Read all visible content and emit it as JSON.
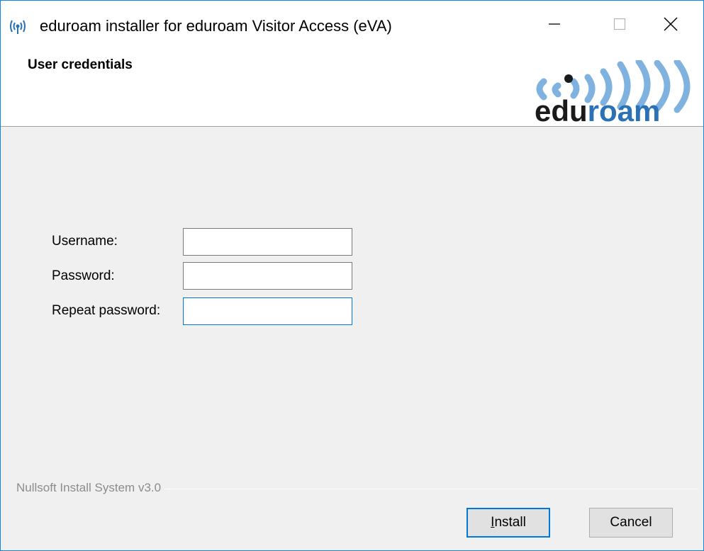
{
  "window": {
    "title": "eduroam installer for eduroam Visitor Access (eVA)"
  },
  "header": {
    "title": "User credentials",
    "logo_text": "eduroam",
    "logo_colors": {
      "edu": "#1a1a1a",
      "roam": "#2a72b5",
      "waves": "#7fb2df"
    }
  },
  "form": {
    "username_label": "Username:",
    "username_value": "",
    "password_label": "Password:",
    "password_value": "",
    "repeat_label": "Repeat password:",
    "repeat_value": ""
  },
  "footer": {
    "branding": "Nullsoft Install System v3.0",
    "install_label": "Install",
    "cancel_label": "Cancel"
  },
  "colors": {
    "accent": "#0078d7",
    "dialog_bg": "#f0f0f0"
  },
  "icons": [
    "eduroam-app-icon",
    "minimize-icon",
    "maximize-icon",
    "close-icon"
  ]
}
